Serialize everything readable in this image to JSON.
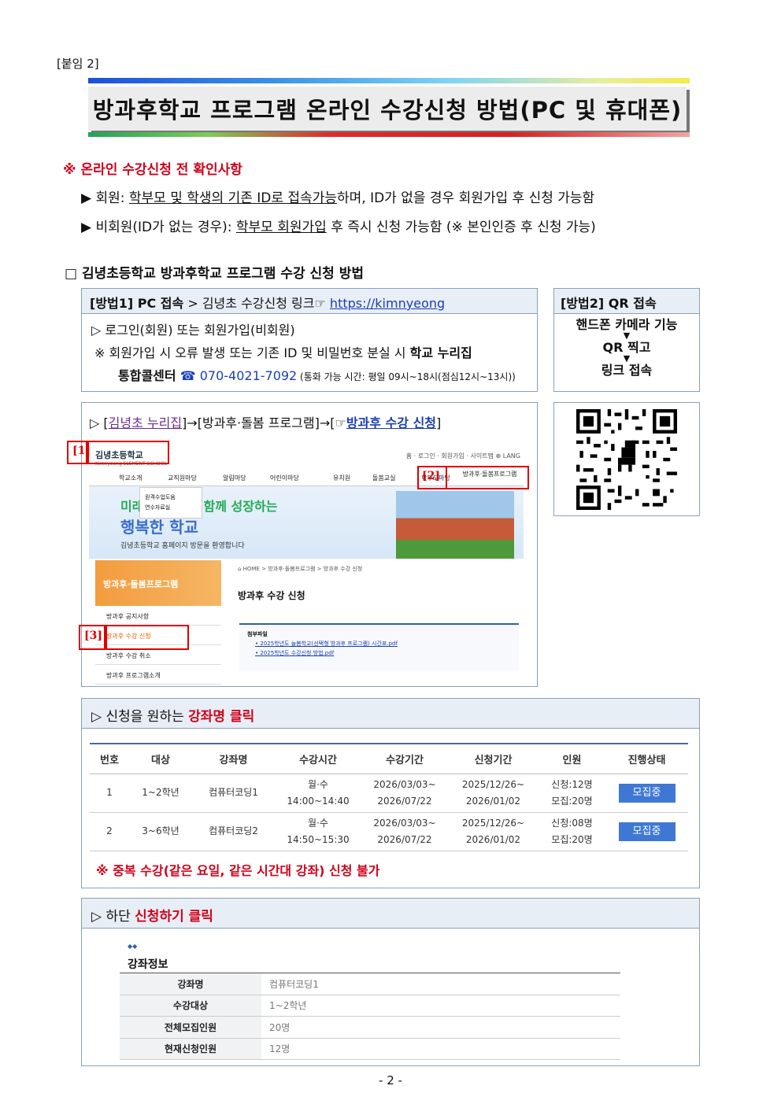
{
  "attach": "[붙임 2]",
  "title": "방과후학교 프로그램 온라인 수강신청 방법(PC 및 휴대폰)",
  "notice": {
    "heading": "※ 온라인 수강신청 전 확인사항",
    "b1_prefix": "▶ 회원: ",
    "b1_u": "학부모 및 학생의 기존 ID로 접속가능",
    "b1_suffix": "하며, ID가 없을 경우 회원가입 후 신청 가능함",
    "b2_prefix": "▶ 비회원(ID가 없는 경우): ",
    "b2_u": "학부모 회원가입",
    "b2_suffix": " 후 즉시 신청 가능함 (※ 본인인증 후 신청 가능)"
  },
  "section_title": "□ 김녕초등학교 방과후학교 프로그램 수강 신청 방법",
  "method1": {
    "head_bold": "[방법1] PC 접속",
    "head_text": " > 김녕초 수강신청 링크☞ ",
    "link": "https://kimnyeong",
    "line1": "▷ 로그인(회원) 또는 회원가입(비회원)",
    "line2_a": "※ 회원가입 시 오류 발생 또는 기존 ID 및 비밀번호 분실 시 ",
    "line2_b": "학교 누리집",
    "line3_a": "통합콜센터",
    "tel": " ☎ 070-4021-7092",
    "hours": " (통화 가능 시간: 평일 09시~18시(점심12시~13시))"
  },
  "method2": {
    "head": "[방법2] QR 접속",
    "s1": "핸드폰 카메라 기능",
    "arrow": "▼",
    "s2": "QR 찍고",
    "s3": "링크 접속"
  },
  "nav": {
    "a": "▷ [",
    "p": "김녕초 누리집",
    "b": "]→[방과후·돌봄 프로그램]→[☞",
    "c": "방과후 수강 신청",
    "d": "]"
  },
  "web": {
    "logo": "김녕초등학교",
    "logo_sub": "Kimnyeong ELEMENT SCHOOL",
    "toplinks": "홈 · 로그인 · 회원가입 · 사이트맵   ⊕ LANG",
    "menu": [
      "학교소개",
      "교직원마당",
      "알림마당",
      "어린이마당",
      "유치원",
      "돌봄교실",
      "학부모마당",
      "방과후·돌봄프로그램"
    ],
    "drop": [
      "원격수업도움",
      "연수자료실"
    ],
    "hero1": "미래를 꿈꾸고, 함께 성장하는",
    "hero2": "행복한 학교",
    "hero3": "김녕초등학교 홈페이지 방문을 환영합니다",
    "side_head": "방과후·돌봄프로그램",
    "side": [
      "방과후 공지사항",
      "방과후 수강 신청",
      "방과후 수강 취소",
      "방과후 프로그램소개"
    ],
    "crumb": "⌂ HOME  >  방과후·돌봄프로그램  >  방과후 수강 신청",
    "main_title": "방과후 수강 신청",
    "att_title": "첨부파일",
    "att1": "• 2025학년도 늘봄학교(선택형 방과후 프로그램) 시간표.pdf",
    "att2": "• 2025학년도 수강신청 방법.pdf",
    "l1": "[1]",
    "l2": "[2]",
    "l3": "[3]"
  },
  "step3": {
    "prefix": "▷ 신청을 원하는 ",
    "bold": "강좌명 클릭",
    "headers": [
      "번호",
      "대상",
      "강좌명",
      "수강시간",
      "수강기간",
      "신청기간",
      "인원",
      "진행상태"
    ],
    "rows": [
      {
        "no": "1",
        "target": "1~2학년",
        "name": "컴퓨터코딩1",
        "time1": "월·수",
        "time2": "14:00~14:40",
        "p1": "2026/03/03~",
        "p2": "2026/07/22",
        "a1": "2025/12/26~",
        "a2": "2026/01/02",
        "n1": "신청:12명",
        "n2": "모집:20명",
        "status": "모집중"
      },
      {
        "no": "2",
        "target": "3~6학년",
        "name": "컴퓨터코딩2",
        "time1": "월·수",
        "time2": "14:50~15:30",
        "p1": "2026/03/03~",
        "p2": "2026/07/22",
        "a1": "2025/12/26~",
        "a2": "2026/01/02",
        "n1": "신청:08명",
        "n2": "모집:20명",
        "status": "모집중"
      }
    ],
    "warn": "※ 중복 수강(같은 요일, 같은 시간대 강좌) 신청 불가"
  },
  "step4": {
    "prefix": "▷ 하단 ",
    "bold": "신청하기 클릭",
    "dots": "◆◆",
    "info_title": "강좌정보",
    "info": [
      {
        "k": "강좌명",
        "v": "컴퓨터코딩1"
      },
      {
        "k": "수강대상",
        "v": "1~2학년"
      },
      {
        "k": "전체모집인원",
        "v": "20명"
      },
      {
        "k": "현재신청인원",
        "v": "12명"
      }
    ]
  },
  "page": "- 2 -"
}
